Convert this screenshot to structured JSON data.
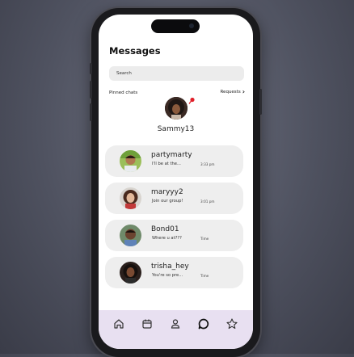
{
  "screen": {
    "title": "Messages",
    "search": {
      "placeholder": "Search"
    },
    "pinned": {
      "label": "Pinned chats",
      "requests_label": "Requests",
      "contact": {
        "name": "Sammy13"
      }
    },
    "chats": [
      {
        "name": "partymarty",
        "preview": "I'll be at the...",
        "time": "3:33 pm"
      },
      {
        "name": "maryyy2",
        "preview": "Join our group!",
        "time": "3:01 pm"
      },
      {
        "name": "Bond01",
        "preview": "Where u at???",
        "time": "Time"
      },
      {
        "name": "trisha_hey",
        "preview": "You're so pre...",
        "time": "Time"
      }
    ],
    "tabbar": {
      "items": [
        {
          "icon": "home-icon"
        },
        {
          "icon": "calendar-icon"
        },
        {
          "icon": "profile-icon"
        },
        {
          "icon": "chat-icon",
          "active": true
        },
        {
          "icon": "star-icon"
        }
      ]
    }
  },
  "colors": {
    "tabbar_bg": "#e8e0f1",
    "chat_bg": "#eeeeee",
    "pin_accent": "#e0202a"
  }
}
